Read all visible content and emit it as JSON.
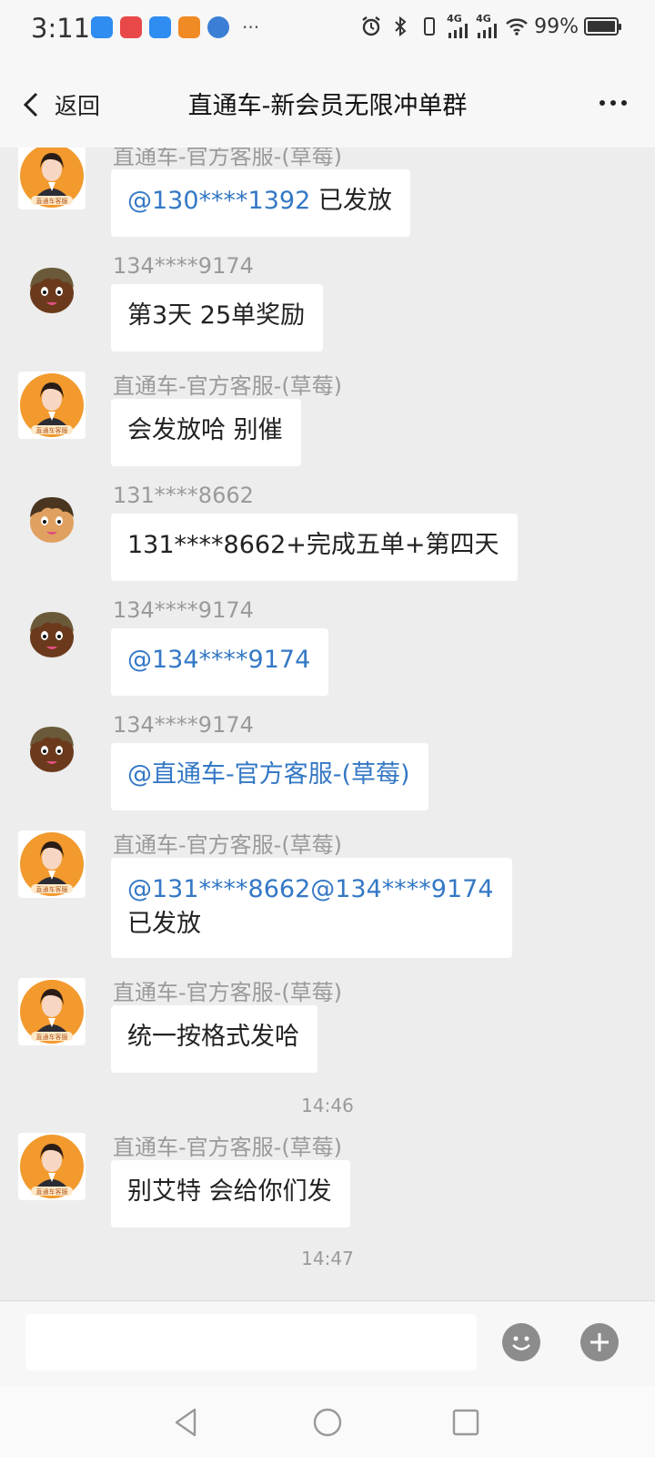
{
  "status_bar": {
    "time": "3:11",
    "battery": "99%",
    "battery_level": 0.99,
    "network_1": "4G",
    "network_2": "4G",
    "app_icons": [
      "message-icon",
      "game-icon",
      "message-icon",
      "photo-app-icon",
      "browser-icon"
    ],
    "more": "···"
  },
  "header": {
    "back_label": "返回",
    "title": "直通车-新会员无限冲单群"
  },
  "colors": {
    "mention": "#3478c5",
    "sender": "#9a9a9a",
    "background": "#ededed",
    "bubble": "#ffffff"
  },
  "messages": [
    {
      "sender": "直通车-官方客服-(草莓)",
      "avatar": "agent-avatar",
      "parts": [
        {
          "text": "@130****1392",
          "mention": true
        },
        {
          "text": " 已发放",
          "mention": false
        }
      ]
    },
    {
      "sender": "134****9174",
      "avatar": "cartoon-avatar",
      "parts": [
        {
          "text": "第3天 25单奖励",
          "mention": false
        }
      ]
    },
    {
      "sender": "直通车-官方客服-(草莓)",
      "avatar": "agent-avatar",
      "parts": [
        {
          "text": "会发放哈 别催",
          "mention": false
        }
      ]
    },
    {
      "sender": "131****8662",
      "avatar": "cartoon-avatar",
      "parts": [
        {
          "text": "131****8662+完成五单+第四天",
          "mention": false
        }
      ]
    },
    {
      "sender": "134****9174",
      "avatar": "cartoon-avatar",
      "parts": [
        {
          "text": "@134****9174",
          "mention": true
        }
      ]
    },
    {
      "sender": "134****9174",
      "avatar": "cartoon-avatar",
      "parts": [
        {
          "text": "@直通车-官方客服-(草莓)",
          "mention": true
        }
      ]
    },
    {
      "sender": "直通车-官方客服-(草莓)",
      "avatar": "agent-avatar",
      "parts": [
        {
          "text": "@131****8662@134****9174",
          "mention": true
        },
        {
          "text": "已发放",
          "mention": false,
          "newline": true
        }
      ]
    },
    {
      "sender": "直通车-官方客服-(草莓)",
      "avatar": "agent-avatar",
      "parts": [
        {
          "text": "统一按格式发哈",
          "mention": false
        }
      ]
    },
    {
      "timestamp": "14:46"
    },
    {
      "sender": "直通车-官方客服-(草莓)",
      "avatar": "agent-avatar",
      "parts": [
        {
          "text": "别艾特 会给你们发",
          "mention": false
        }
      ]
    },
    {
      "timestamp": "14:47"
    }
  ],
  "avatar_caption": "直通车客服",
  "input": {
    "value": "",
    "placeholder": ""
  }
}
